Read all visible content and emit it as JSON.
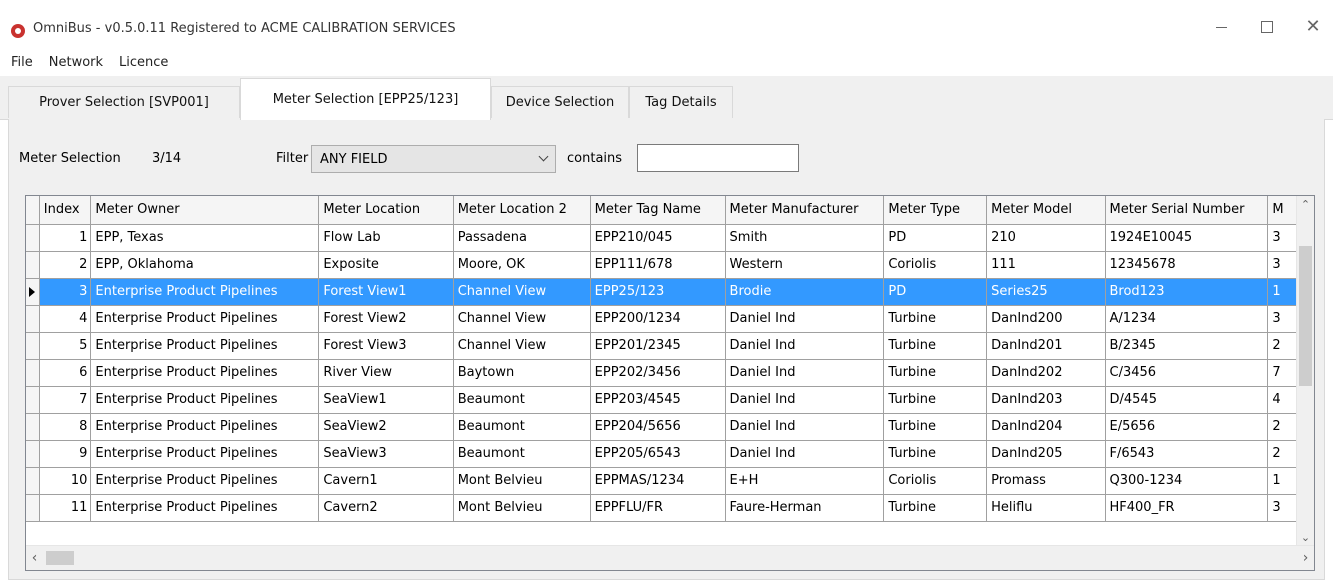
{
  "window": {
    "title": "OmniBus - v0.5.0.11  Registered to ACME CALIBRATION SERVICES",
    "icon": "app-logo-icon"
  },
  "menu": {
    "items": [
      "File",
      "Network",
      "Licence"
    ]
  },
  "tabs": [
    {
      "label": "Prover Selection [SVP001]",
      "active": false
    },
    {
      "label": "Meter Selection [EPP25/123]",
      "active": true
    },
    {
      "label": "Device Selection",
      "active": false
    },
    {
      "label": "Tag Details",
      "active": false
    }
  ],
  "filter": {
    "section_label": "Meter Selection",
    "count": "3/14",
    "filter_label": "Filter",
    "field_value": "ANY FIELD",
    "contains_label": "contains",
    "contains_value": ""
  },
  "grid": {
    "columns": [
      "Index",
      "Meter Owner",
      "Meter Location",
      "Meter Location 2",
      "Meter Tag Name",
      "Meter Manufacturer",
      "Meter Type",
      "Meter Model",
      "Meter Serial Number",
      "M"
    ],
    "selected_index": 3,
    "rows": [
      [
        "1",
        "EPP, Texas",
        "Flow Lab",
        "Passadena",
        "EPP210/045",
        "Smith",
        "PD",
        "210",
        "1924E10045",
        "3"
      ],
      [
        "2",
        "EPP, Oklahoma",
        "Exposite",
        "Moore, OK",
        "EPP111/678",
        "Western",
        "Coriolis",
        "111",
        "12345678",
        "3"
      ],
      [
        "3",
        "Enterprise Product Pipelines",
        "Forest View1",
        "Channel View",
        "EPP25/123",
        "Brodie",
        "PD",
        "Series25",
        "Brod123",
        "1"
      ],
      [
        "4",
        "Enterprise Product Pipelines",
        "Forest View2",
        "Channel View",
        "EPP200/1234",
        "Daniel Ind",
        "Turbine",
        "DanInd200",
        "A/1234",
        "3"
      ],
      [
        "5",
        "Enterprise Product Pipelines",
        "Forest View3",
        "Channel View",
        "EPP201/2345",
        "Daniel Ind",
        "Turbine",
        "DanInd201",
        "B/2345",
        "2"
      ],
      [
        "6",
        "Enterprise Product Pipelines",
        "River View",
        "Baytown",
        "EPP202/3456",
        "Daniel Ind",
        "Turbine",
        "DanInd202",
        "C/3456",
        "7"
      ],
      [
        "7",
        "Enterprise Product Pipelines",
        "SeaView1",
        "Beaumont",
        "EPP203/4545",
        "Daniel Ind",
        "Turbine",
        "DanInd203",
        "D/4545",
        "4"
      ],
      [
        "8",
        "Enterprise Product Pipelines",
        "SeaView2",
        "Beaumont",
        "EPP204/5656",
        "Daniel Ind",
        "Turbine",
        "DanInd204",
        "E/5656",
        "2"
      ],
      [
        "9",
        "Enterprise Product Pipelines",
        "SeaView3",
        "Beaumont",
        "EPP205/6543",
        "Daniel Ind",
        "Turbine",
        "DanInd205",
        "F/6543",
        "2"
      ],
      [
        "10",
        "Enterprise Product Pipelines",
        "Cavern1",
        "Mont Belvieu",
        "EPPMAS/1234",
        "E+H",
        "Coriolis",
        "Promass",
        "Q300-1234",
        "1"
      ],
      [
        "11",
        "Enterprise Product Pipelines",
        "Cavern2",
        "Mont Belvieu",
        "EPPFLU/FR",
        "Faure-Herman",
        "Turbine",
        "Heliflu",
        "HF400_FR",
        "3"
      ]
    ]
  },
  "icons": {
    "minimize": "minimize-icon",
    "maximize": "maximize-icon",
    "close": "close-icon",
    "dropdown": "chevron-down-icon",
    "current_row": "row-pointer-icon"
  }
}
